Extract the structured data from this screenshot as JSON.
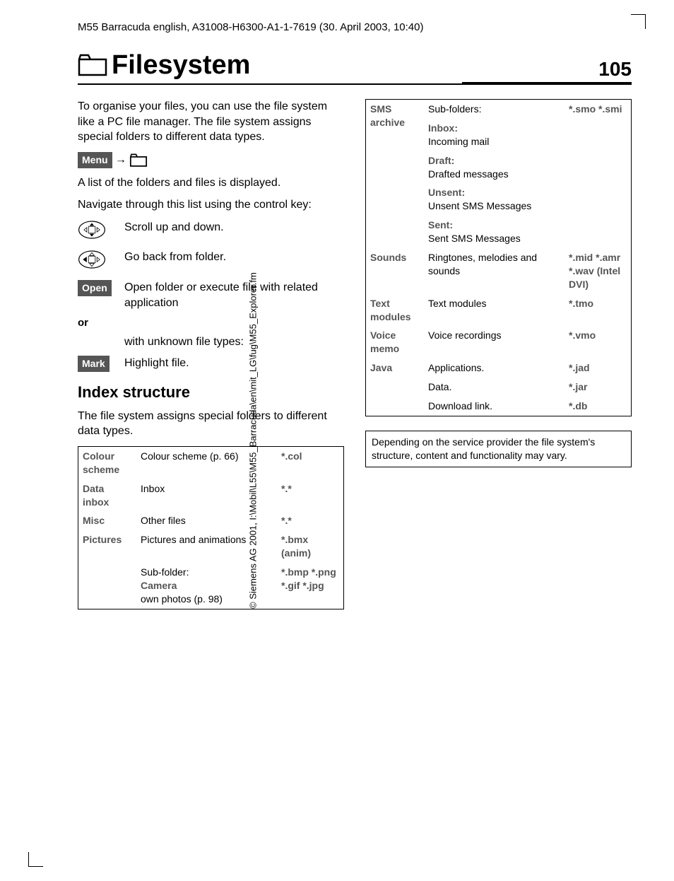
{
  "meta": {
    "header": "M55 Barracuda english, A31008-H6300-A1-1-7619 (30. April 2003, 10:40)",
    "copyright": "© Siemens AG 2001, I:\\Mobil\\L55\\M55_Barracuda\\en\\mit_LG\\fug\\M55_Explorer.fm"
  },
  "title": "Filesystem",
  "page_number": "105",
  "intro": {
    "p1": "To organise your files, you can use the file system like a PC file manager. The file system assigns special folders to different data types.",
    "menu_label": "Menu",
    "arrow": "→",
    "p2": "A list of the folders and files is displayed.",
    "p3": "Navigate through this list using the control key:"
  },
  "nav": {
    "scroll": "Scroll up and down.",
    "back": "Go back from folder.",
    "open_label": "Open",
    "open_text": "Open folder or execute file with related application",
    "or": "or",
    "unknown": "with unknown file types:",
    "mark_label": "Mark",
    "mark_text": "Highlight file."
  },
  "index": {
    "heading": "Index structure",
    "intro": "The file system assigns special folders to different data types."
  },
  "table1": {
    "r1": {
      "label": "Colour scheme",
      "desc": "Colour scheme (p. 66)",
      "ext": "*.col"
    },
    "r2": {
      "label": "Data inbox",
      "desc": "Inbox",
      "ext": "*.*"
    },
    "r3": {
      "label": "Misc",
      "desc": "Other files",
      "ext": "*.*"
    },
    "r4": {
      "label": "Pictures",
      "desc1": "Pictures and animations",
      "ext1": "*.bmx (anim)",
      "desc2": "Sub-folder:",
      "desc3": "Camera",
      "desc4": "own photos (p. 98)",
      "ext2": "*.bmp *.png *.gif *.jpg"
    }
  },
  "table2": {
    "sms": {
      "label": "SMS archive",
      "subfolders": "Sub-folders:",
      "ext": "*.smo *.smi",
      "inbox_l": "Inbox:",
      "inbox_d": "Incoming mail",
      "draft_l": "Draft:",
      "draft_d": "Drafted messages",
      "unsent_l": "Unsent:",
      "unsent_d": "Unsent SMS Messages",
      "sent_l": "Sent:",
      "sent_d": "Sent SMS Messages"
    },
    "sounds": {
      "label": "Sounds",
      "desc": "Ringtones, melodies and sounds",
      "ext": "*.mid *.amr *.wav (Intel DVI)"
    },
    "text": {
      "label": "Text modules",
      "desc": "Text modules",
      "ext": "*.tmo"
    },
    "voice": {
      "label": "Voice memo",
      "desc": "Voice recordings",
      "ext": "*.vmo"
    },
    "java": {
      "label": "Java",
      "r1d": "Applications.",
      "r1e": "*.jad",
      "r2d": "Data.",
      "r2e": "*.jar",
      "r3d": "Download link.",
      "r3e": "*.db"
    }
  },
  "note": "Depending on the service provider the file system's structure, content and functionality may vary."
}
